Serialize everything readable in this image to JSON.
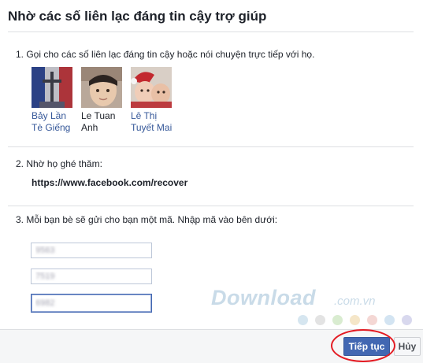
{
  "dialog": {
    "title": "Nhờ các số liên lạc đáng tin cậy trợ giúp"
  },
  "step1": {
    "text": "1. Gọi cho các số liên lạc đáng tin cậy hoặc nói chuyện trực tiếp với họ.",
    "contacts": [
      {
        "line1": "Bảy Lần",
        "line2": "Tè Giếng",
        "is_link": true
      },
      {
        "line1": "Le Tuan",
        "line2": "Anh",
        "is_link": false
      },
      {
        "line1": "Lê Thị",
        "line2": "Tuyết Mai",
        "is_link": true
      }
    ]
  },
  "step2": {
    "text": "2. Nhờ họ ghé thăm:",
    "url": "https://www.facebook.com/recover"
  },
  "step3": {
    "text": "3. Mỗi bạn bè sẽ gửi cho bạn một mã. Nhập mã vào bên dưới:",
    "codes": [
      "9563",
      "7519",
      "6982"
    ]
  },
  "buttons": {
    "continue": "Tiếp tục",
    "cancel": "Hủy"
  },
  "watermark": {
    "brand": "Download",
    "suffix": ".com.vn",
    "dot_colors": [
      "#d6e6f0",
      "#e3e3e3",
      "#d9ecd0",
      "#f5e6c8",
      "#f4d7d4",
      "#d3e4f2",
      "#d8d8ee"
    ]
  },
  "colors": {
    "primary": "#4267b2",
    "link": "#365899",
    "highlight_ring": "#e31b23"
  }
}
